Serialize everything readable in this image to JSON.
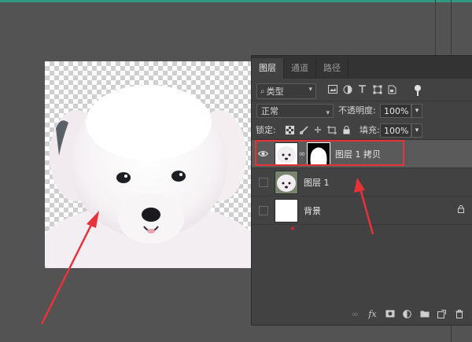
{
  "panel": {
    "tabs": [
      {
        "label": "图层",
        "active": true
      },
      {
        "label": "通道",
        "active": false
      },
      {
        "label": "路径",
        "active": false
      }
    ],
    "filter": {
      "label": "类型"
    },
    "blend_mode": "正常",
    "opacity": {
      "label": "不透明度:",
      "value": "100%"
    },
    "lock": {
      "label": "锁定:"
    },
    "fill": {
      "label": "填充:",
      "value": "100%"
    },
    "layers": [
      {
        "name": "图层 1 拷贝",
        "visible": true,
        "selected": true,
        "has_mask": true
      },
      {
        "name": "图层 1",
        "visible": false,
        "selected": false,
        "has_mask": false
      },
      {
        "name": "背景",
        "visible": false,
        "selected": false,
        "locked": true
      }
    ]
  },
  "icons": {
    "filter": [
      "image-filter-icon",
      "adjustment-filter-icon",
      "type-filter-icon",
      "shape-filter-icon",
      "smart-object-filter-icon"
    ],
    "lock": [
      "lock-transparent-icon",
      "lock-paint-icon",
      "lock-position-icon",
      "lock-artboard-icon",
      "lock-all-icon"
    ],
    "bottom": [
      "link-icon",
      "fx-icon",
      "add-mask-icon",
      "adjustment-icon",
      "group-icon",
      "new-layer-icon",
      "trash-icon"
    ]
  },
  "colors": {
    "highlight": "#e8323a",
    "arrow": "#e8323a",
    "panel_bg": "#424242",
    "workspace_bg": "#535353",
    "accent_strip": "#2f9a84"
  }
}
